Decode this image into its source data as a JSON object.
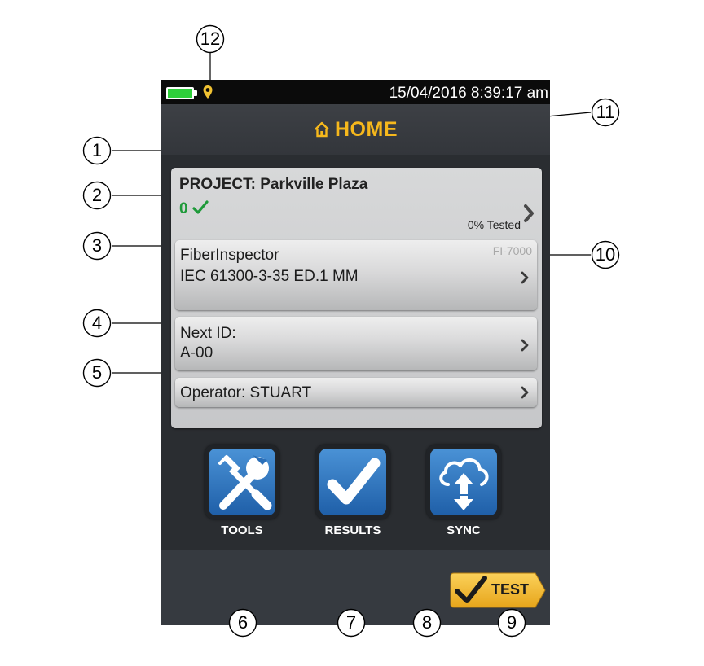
{
  "status_bar": {
    "battery_color": "#2ecf3a",
    "datetime": "15/04/2016 8:39:17 am"
  },
  "header": {
    "title": "HOME",
    "title_color": "#f6b81c",
    "icon": "home-icon"
  },
  "project": {
    "title": "PROJECT: Parkville Plaza",
    "tested_count": "0",
    "tested_percent": "0% Tested"
  },
  "test_setup": {
    "line1": "FiberInspector",
    "line2": "IEC 61300-3-35 ED.1 MM",
    "model": "FI-7000"
  },
  "next_id": {
    "line1": "Next ID:",
    "line2": "A-00"
  },
  "operator": {
    "label": "Operator: STUART"
  },
  "apps": [
    {
      "label": "TOOLS",
      "icon": "tools-icon"
    },
    {
      "label": "RESULTS",
      "icon": "results-check-icon"
    },
    {
      "label": "SYNC",
      "icon": "cloud-sync-icon"
    }
  ],
  "test_button": {
    "label": "TEST",
    "color": "#f5b82a"
  },
  "callouts": [
    "1",
    "2",
    "3",
    "4",
    "5",
    "6",
    "7",
    "8",
    "9",
    "10",
    "11",
    "12"
  ]
}
